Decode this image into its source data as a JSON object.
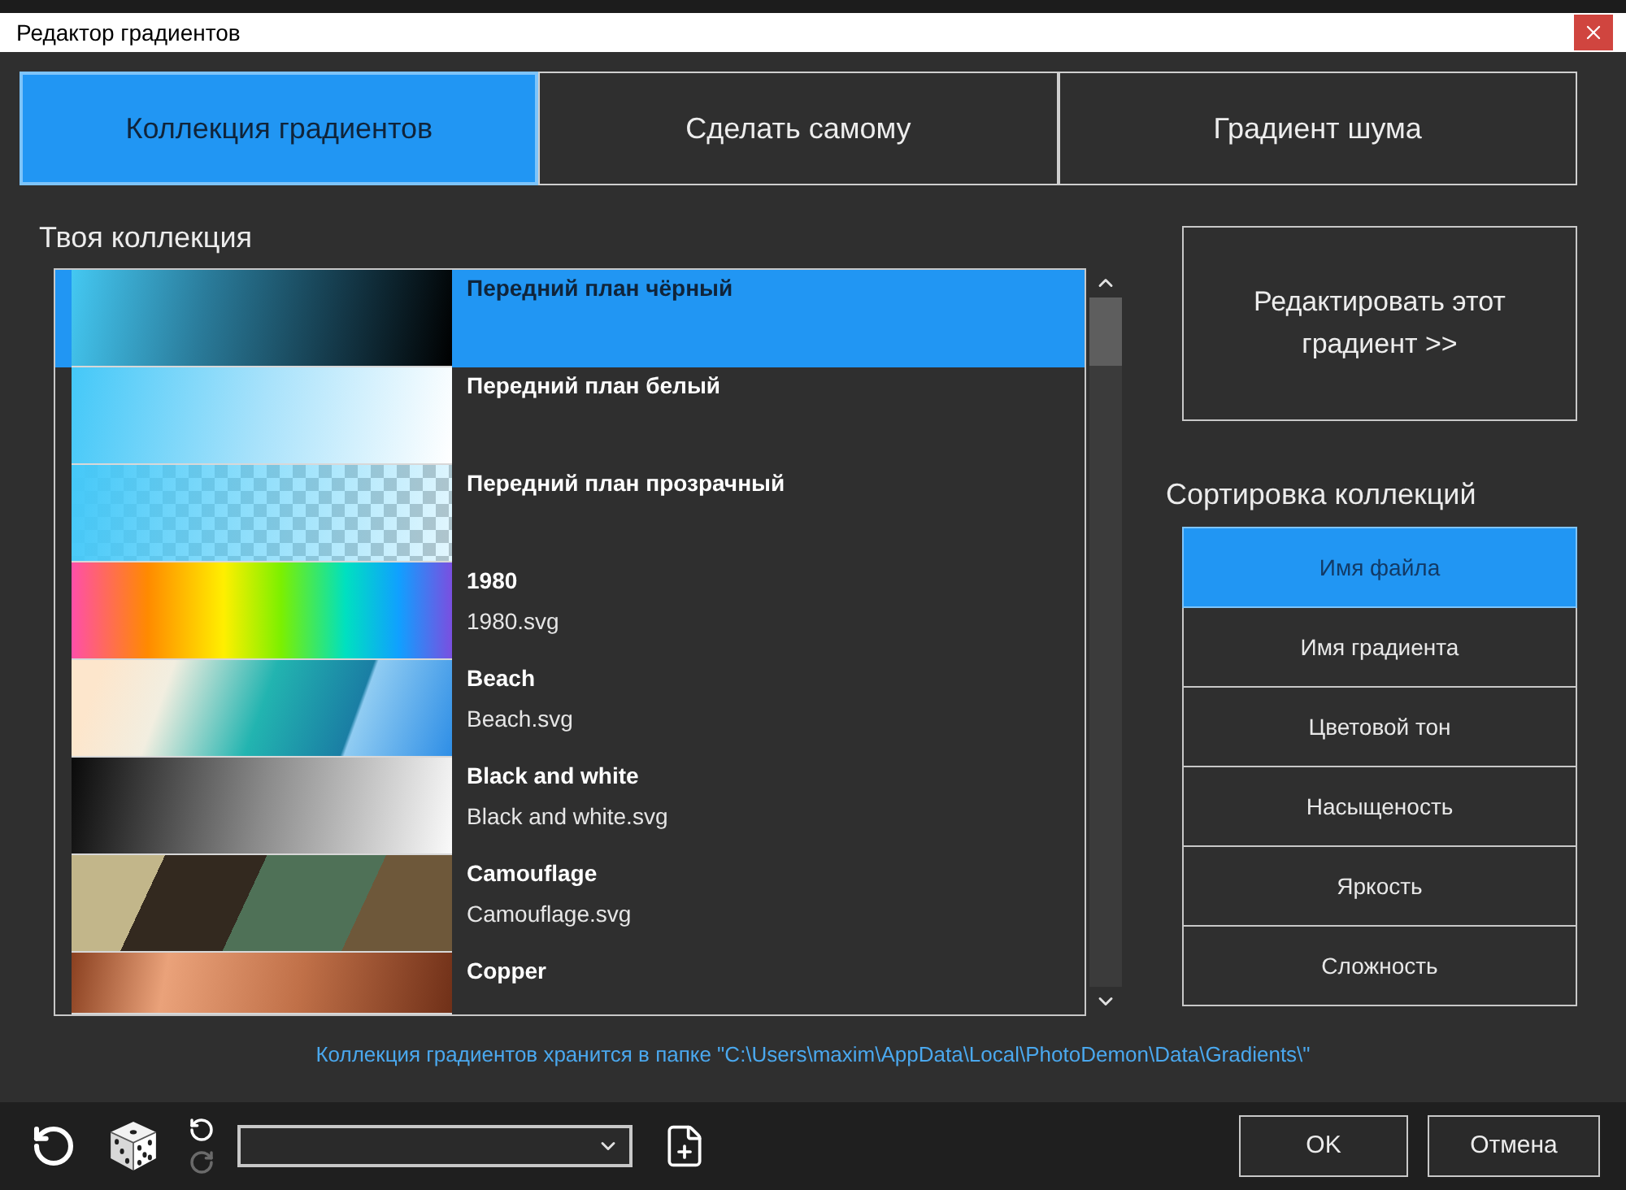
{
  "window": {
    "title": "Редактор градиентов"
  },
  "tabs": [
    {
      "label": "Коллекция градиентов",
      "selected": true
    },
    {
      "label": "Сделать самому",
      "selected": false
    },
    {
      "label": "Градиент шума",
      "selected": false
    }
  ],
  "collection": {
    "title": "Твоя коллекция",
    "items": [
      {
        "name": "Передний план чёрный",
        "selected": true
      },
      {
        "name": "Передний план белый",
        "selected": false
      },
      {
        "name": "Передний план прозрачный",
        "selected": false
      },
      {
        "name": "1980",
        "file": "1980.svg",
        "selected": false
      },
      {
        "name": "Beach",
        "file": "Beach.svg",
        "selected": false
      },
      {
        "name": "Black and white",
        "file": "Black and white.svg",
        "selected": false
      },
      {
        "name": "Camouflage",
        "file": "Camouflage.svg",
        "selected": false
      },
      {
        "name": "Copper",
        "selected": false
      }
    ]
  },
  "edit_button": "Редактировать этот градиент >>",
  "sort": {
    "title": "Сортировка коллекций",
    "options": [
      {
        "label": "Имя файла",
        "selected": true
      },
      {
        "label": "Имя градиента",
        "selected": false
      },
      {
        "label": "Цветовой тон",
        "selected": false
      },
      {
        "label": "Насыщеность",
        "selected": false
      },
      {
        "label": "Яркость",
        "selected": false
      },
      {
        "label": "Сложность",
        "selected": false
      }
    ]
  },
  "folder_note": "Коллекция градиентов хранится в папке \"C:\\Users\\maxim\\AppData\\Local\\PhotoDemon\\Data\\Gradients\\\"",
  "toolbar": {
    "undo": {
      "disabled": false
    },
    "redo": {
      "disabled": true
    }
  },
  "buttons": [
    "OK",
    "Отмена"
  ]
}
